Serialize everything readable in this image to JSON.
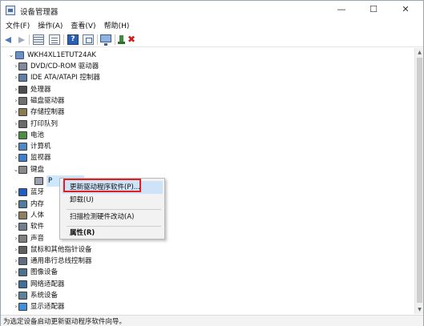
{
  "window": {
    "title": "设备管理器",
    "min_glyph": "—",
    "max_glyph": "☐",
    "close_glyph": "✕"
  },
  "menu": [
    "文件(F)",
    "操作(A)",
    "查看(V)",
    "帮助(H)"
  ],
  "toolbar": {
    "icons": [
      "back-icon",
      "forward-icon",
      "list-view-icon",
      "properties-icon",
      "help-icon",
      "scan-hardware-icon",
      "monitor-icon",
      "update-driver-icon",
      "uninstall-icon"
    ],
    "help_glyph": "?",
    "uninstall_glyph": "✖"
  },
  "tree": {
    "root": "WKH4XL1ETUT24AK",
    "expand_glyph": "⌄",
    "collapse_glyph": "›",
    "items": [
      {
        "label": "DVD/CD-ROM 驱动器",
        "icon": "dvd-drive-icon"
      },
      {
        "label": "IDE ATA/ATAPI 控制器",
        "icon": "ide-controller-icon"
      },
      {
        "label": "处理器",
        "icon": "processor-icon"
      },
      {
        "label": "磁盘驱动器",
        "icon": "disk-drive-icon"
      },
      {
        "label": "存储控制器",
        "icon": "storage-controller-icon"
      },
      {
        "label": "打印队列",
        "icon": "print-queue-icon"
      },
      {
        "label": "电池",
        "icon": "battery-icon"
      },
      {
        "label": "计算机",
        "icon": "computer-icon"
      },
      {
        "label": "监视器",
        "icon": "monitor-icon"
      },
      {
        "label": "键盘",
        "icon": "keyboard-icon",
        "expanded": true
      },
      {
        "label": "P",
        "icon": "keyboard-device-icon",
        "child": true,
        "selected": true
      },
      {
        "label": "蓝牙",
        "icon": "bluetooth-icon"
      },
      {
        "label": "内存",
        "icon": "memory-icon"
      },
      {
        "label": "人体",
        "icon": "hid-icon"
      },
      {
        "label": "软件",
        "icon": "software-device-icon"
      },
      {
        "label": "声音",
        "icon": "sound-icon"
      },
      {
        "label": "鼠标和其他指针设备",
        "icon": "mouse-icon"
      },
      {
        "label": "通用串行总线控制器",
        "icon": "usb-controller-icon"
      },
      {
        "label": "图像设备",
        "icon": "imaging-device-icon"
      },
      {
        "label": "网络适配器",
        "icon": "network-adapter-icon"
      },
      {
        "label": "系统设备",
        "icon": "system-device-icon"
      },
      {
        "label": "显示适配器",
        "icon": "display-adapter-icon"
      }
    ]
  },
  "context_menu": {
    "items": [
      {
        "label": "更新驱动程序软件(P)...",
        "highlighted": true
      },
      {
        "label": "卸载(U)"
      },
      {
        "label": "扫描检测硬件改动(A)"
      },
      {
        "label": "属性(R)",
        "bold": true
      }
    ]
  },
  "scrollbar": {
    "up_glyph": "▲",
    "down_glyph": "▼"
  },
  "status": "为选定设备启动更新驱动程序软件向导。",
  "colors": {
    "highlight": "#cfe3f8",
    "red_box": "#e02020",
    "selected_row": "#cce8ff"
  }
}
